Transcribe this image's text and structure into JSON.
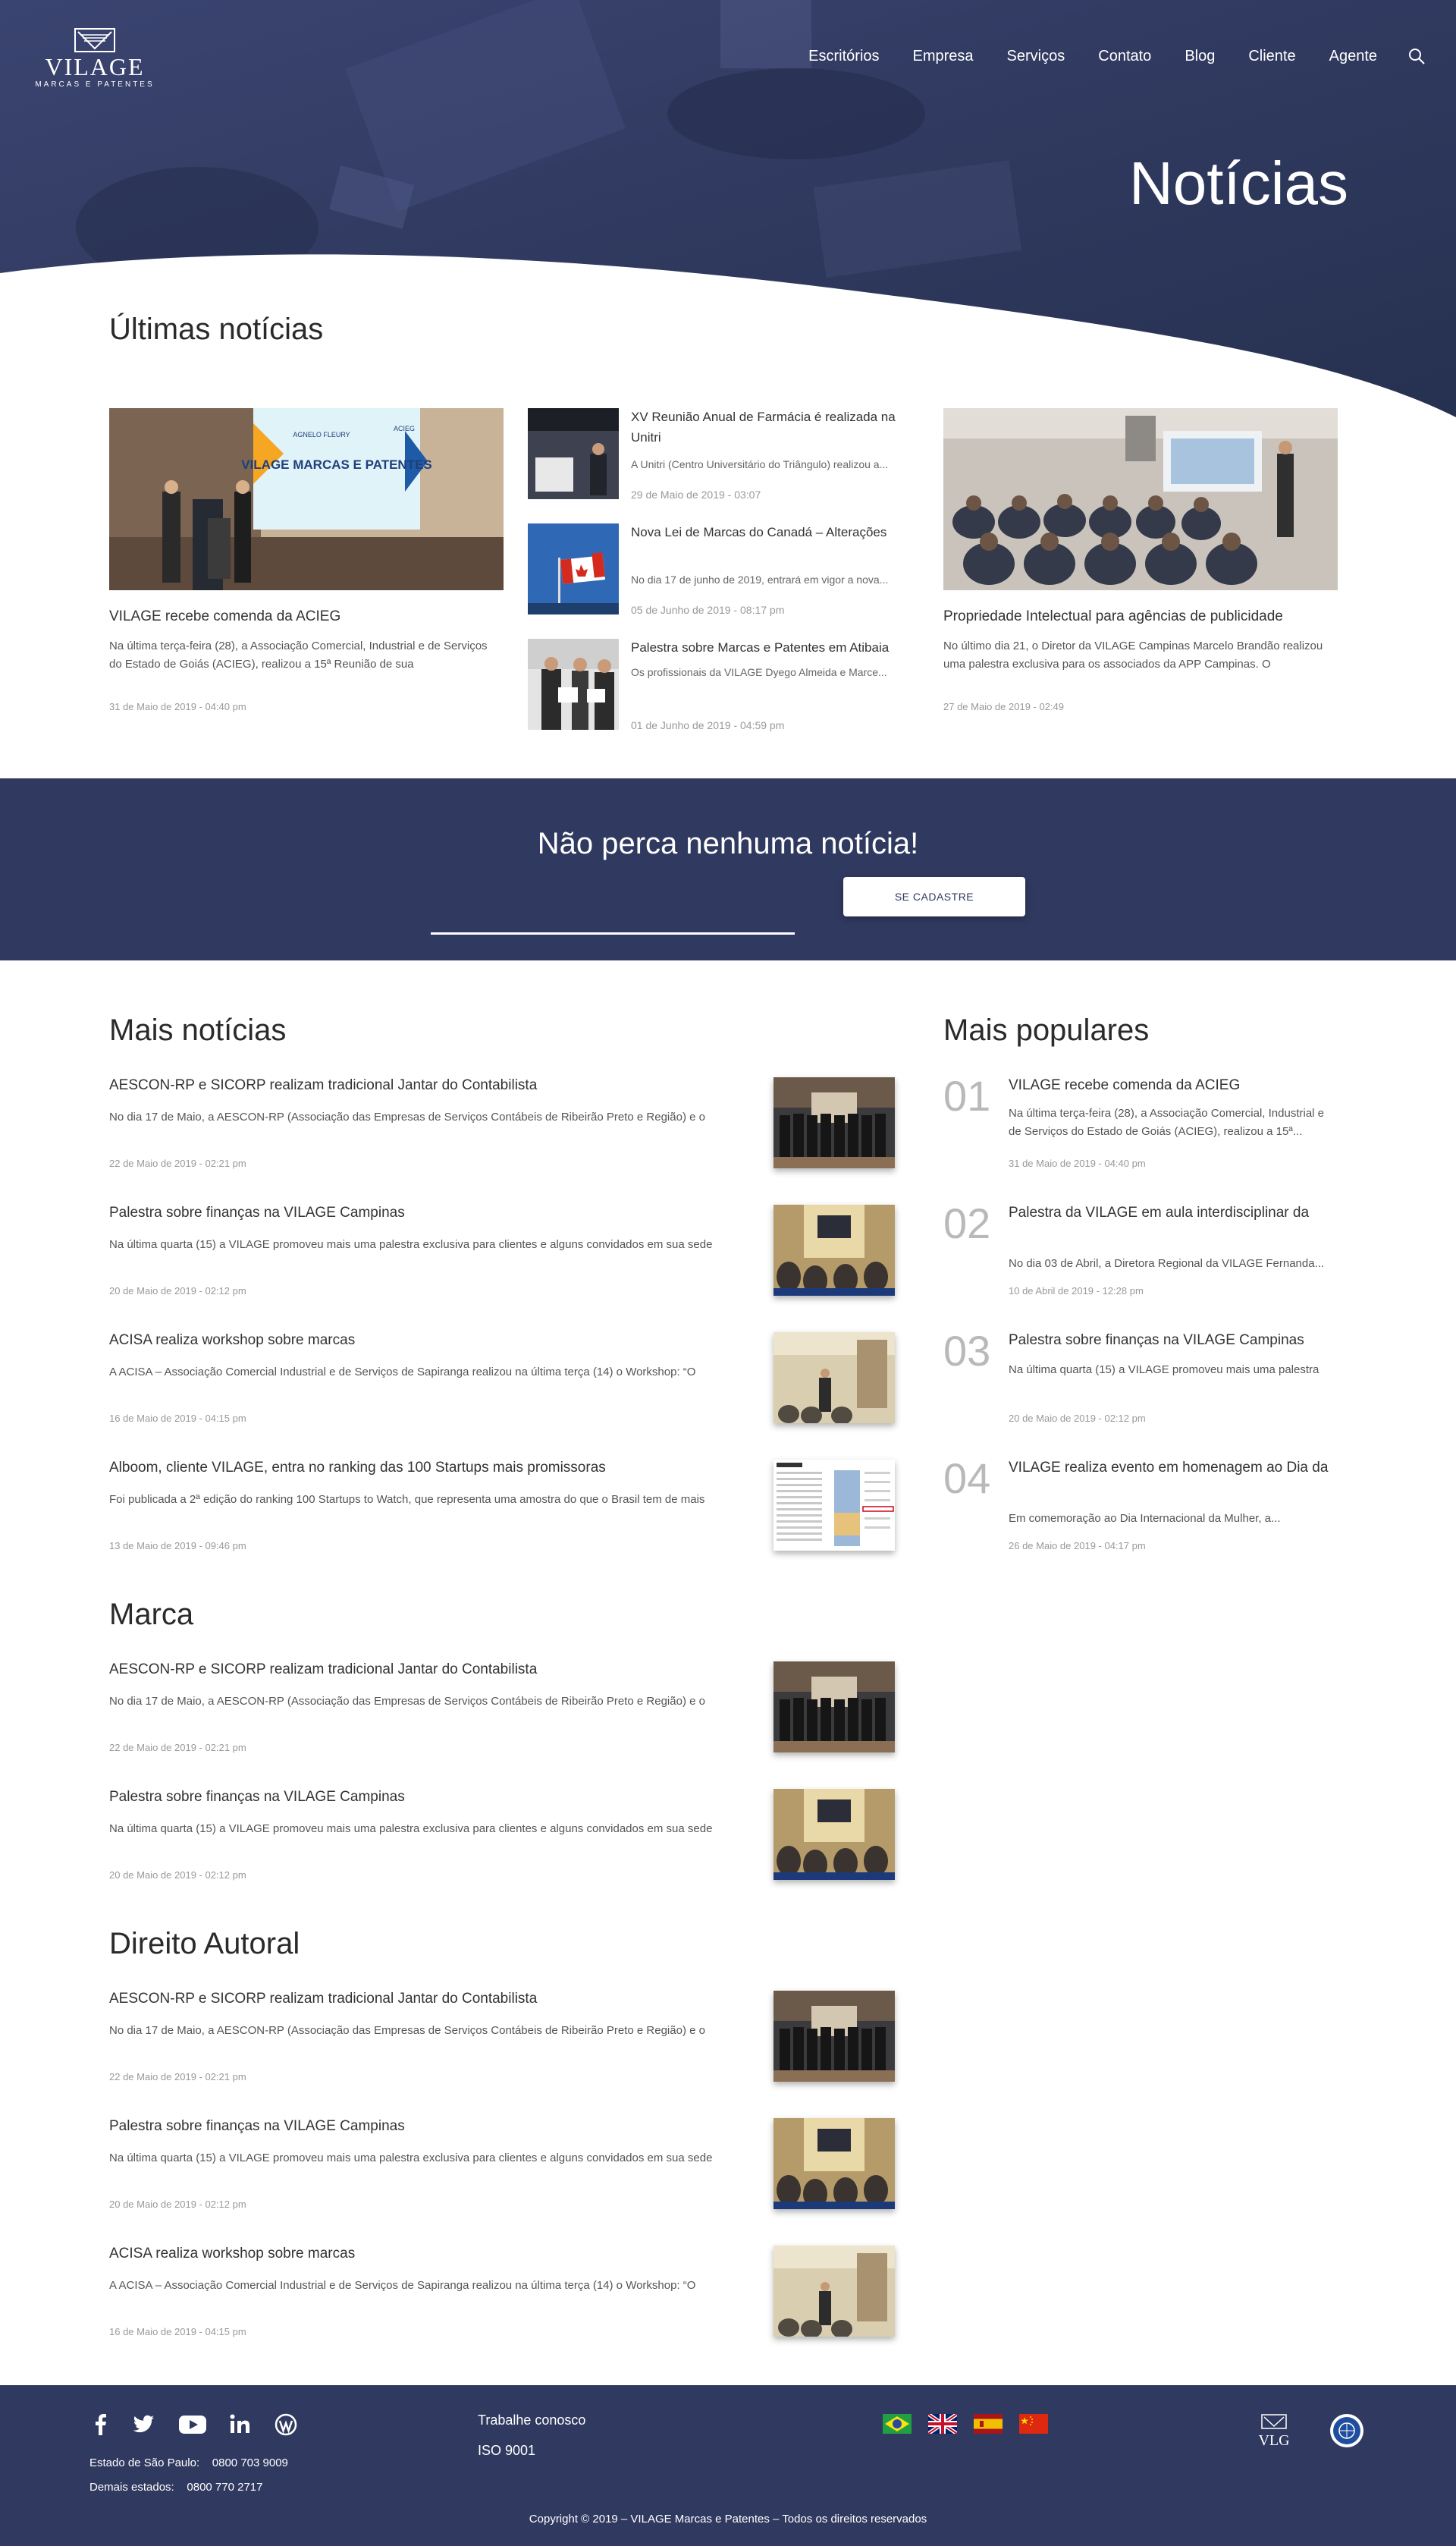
{
  "header": {
    "logo": {
      "brand": "VILAGE",
      "tagline": "MARCAS E PATENTES"
    },
    "nav": [
      "Escritórios",
      "Empresa",
      "Serviços",
      "Contato",
      "Blog",
      "Cliente",
      "Agente"
    ],
    "page_title": "Notícias"
  },
  "colors": {
    "navy": "#30395f",
    "hero_overlay": "#2e3961",
    "text": "#333333",
    "muted": "#999999"
  },
  "latest": {
    "title": "Últimas notícias",
    "featured_left": {
      "image_caption": "VILAGE MARCAS E PATENTES",
      "image_small_text": "AGNELO FLEURY",
      "image_badge": "ACIEG",
      "title": "VILAGE recebe comenda da ACIEG",
      "text": "Na última terça-feira (28), a Associação Comercial, Industrial e de Serviços do Estado de Goiás (ACIEG), realizou a 15ª Reunião de sua",
      "date": "31 de Maio de 2019 - 04:40 pm"
    },
    "middle": [
      {
        "title": "XV Reunião Anual de Farmácia é realizada na Unitri",
        "text": "A Unitri (Centro Universitário do Triângulo) realizou a...",
        "date": "29 de Maio de 2019 - 03:07"
      },
      {
        "title": "Nova Lei de Marcas do Canadá – Alterações",
        "text": "No dia 17 de junho de 2019, entrará em vigor a nova...",
        "date": "05 de Junho de 2019 - 08:17 pm"
      },
      {
        "title": "Palestra sobre Marcas e Patentes em Atibaia",
        "text": "Os profissionais da VILAGE Dyego Almeida e Marce...",
        "date": "01 de Junho de 2019 - 04:59 pm"
      }
    ],
    "featured_right": {
      "title": "Propriedade Intelectual para agências de publicidade",
      "text": "No último dia 21, o Diretor da VILAGE Campinas Marcelo Brandão realizou uma palestra exclusiva para os associados da APP Campinas. O",
      "date": "27 de Maio de 2019 - 02:49"
    }
  },
  "newsletter": {
    "title": "Não perca nenhuma notícia!",
    "input_placeholder": "",
    "button": "SE CADASTRE"
  },
  "mais_noticias": {
    "title": "Mais notícias",
    "items": [
      {
        "title": "AESCON-RP e SICORP realizam tradicional Jantar do Contabilista",
        "text": "No dia 17 de Maio, a AESCON-RP (Associação das Empresas de Serviços Contábeis de Ribeirão Preto e Região) e o",
        "date": "22 de Maio de 2019 - 02:21 pm"
      },
      {
        "title": "Palestra sobre finanças na VILAGE Campinas",
        "text": "Na última quarta (15) a VILAGE promoveu mais uma palestra exclusiva para clientes e alguns convidados em sua sede",
        "date": "20  de Maio de 2019 - 02:12 pm"
      },
      {
        "title": "ACISA realiza workshop sobre marcas",
        "text": "A ACISA – Associação Comercial Industrial e de Serviços de Sapiranga realizou na última terça (14) o Workshop: “O",
        "date": "16 de Maio de 2019 - 04:15 pm"
      },
      {
        "title": "Alboom, cliente VILAGE, entra no ranking das 100 Startups mais promissoras",
        "text": "Foi publicada a 2ª edição do ranking 100 Startups to Watch, que representa uma amostra do que o Brasil tem de mais",
        "date": "13 de Maio de 2019 - 09:46 pm"
      }
    ]
  },
  "marca": {
    "title": "Marca",
    "items": [
      {
        "title": "AESCON-RP e SICORP realizam tradicional Jantar do Contabilista",
        "text": "No dia 17 de Maio, a AESCON-RP (Associação das Empresas de Serviços Contábeis de Ribeirão Preto e Região) e o",
        "date": "22 de Maio de 2019 - 02:21 pm"
      },
      {
        "title": "Palestra sobre finanças na VILAGE Campinas",
        "text": "Na última quarta (15) a VILAGE promoveu mais uma palestra exclusiva para clientes e alguns convidados em sua sede",
        "date": "20  de Maio de 2019 - 02:12 pm"
      }
    ]
  },
  "direito_autoral": {
    "title": "Direito Autoral",
    "items": [
      {
        "title": "AESCON-RP e SICORP realizam tradicional Jantar do Contabilista",
        "text": "No dia 17 de Maio, a AESCON-RP (Associação das Empresas de Serviços Contábeis de Ribeirão Preto e Região) e o",
        "date": "22 de Maio de 2019 - 02:21 pm"
      },
      {
        "title": "Palestra sobre finanças na VILAGE Campinas",
        "text": "Na última quarta (15) a VILAGE promoveu mais uma palestra exclusiva para clientes e alguns convidados em sua sede",
        "date": "20  de Maio de 2019 - 02:12 pm"
      },
      {
        "title": "ACISA realiza workshop sobre marcas",
        "text": "A ACISA – Associação Comercial Industrial e de Serviços de Sapiranga realizou na última terça (14) o Workshop: “O",
        "date": "16 de Maio de 2019 - 04:15 pm"
      }
    ]
  },
  "populares": {
    "title": "Mais populares",
    "items": [
      {
        "num": "01",
        "title": "VILAGE recebe comenda da ACIEG",
        "text": "Na última terça-feira (28), a Associação Comercial, Industrial e de Serviços do Estado de Goiás (ACIEG), realizou a 15ª...",
        "date": "31 de Maio de 2019 - 04:40 pm"
      },
      {
        "num": "02",
        "title": "Palestra da VILAGE em aula interdisciplinar da",
        "text": "No dia 03 de Abril, a Diretora Regional da VILAGE Fernanda...",
        "date": "10 de Abril de 2019 - 12:28 pm"
      },
      {
        "num": "03",
        "title": "Palestra sobre finanças na VILAGE Campinas",
        "text": "Na última quarta (15) a VILAGE promoveu mais uma palestra",
        "date": "20  de Maio de 2019 - 02:12 pm"
      },
      {
        "num": "04",
        "title": "VILAGE realiza evento em homenagem ao Dia da",
        "text": "Em comemoração ao Dia Internacional da Mulher, a...",
        "date": "26 de Maio de 2019 - 04:17 pm"
      }
    ]
  },
  "footer": {
    "social_icons": [
      "facebook-icon",
      "twitter-icon",
      "youtube-icon",
      "linkedin-icon",
      "wordpress-icon"
    ],
    "phone_sp": "Estado de São Paulo:    0800 703 9009",
    "phone_other": "Demais estados:    0800 770 2717",
    "links": [
      "Trabalhe conosco",
      "ISO 9001"
    ],
    "flags": [
      "brazil-flag-icon",
      "uk-flag-icon",
      "spain-flag-icon",
      "china-flag-icon"
    ],
    "vlg_logo": "VLG",
    "copyright": "Copyright © 2019 – VILAGE Marcas e Patentes – Todos os direitos reservados"
  }
}
